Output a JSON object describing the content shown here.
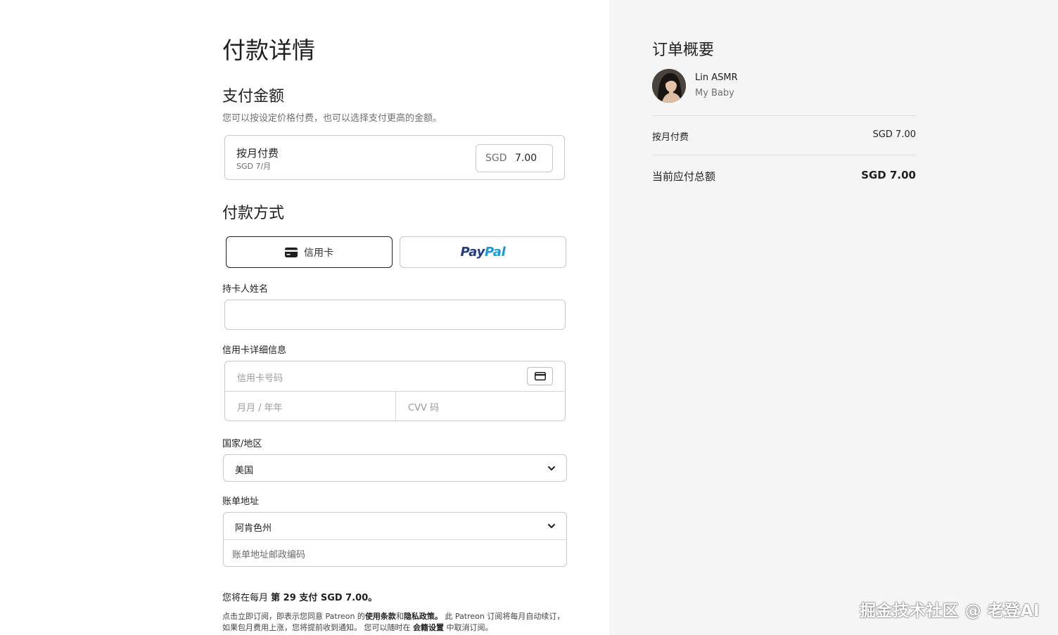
{
  "payment": {
    "title": "付款详情",
    "amount_section_title": "支付金额",
    "amount_section_desc": "您可以按设定价格付费，也可以选择支付更高的金额。",
    "plan_title": "按月付费",
    "plan_sub": "SGD 7/月",
    "currency": "SGD",
    "amount": "7.00",
    "method_section_title": "付款方式",
    "card_button_label": "信用卡",
    "paypal_pay": "Pay",
    "paypal_pal": "Pal",
    "cardholder_label": "持卡人姓名",
    "cardholder_value": "",
    "card_details_label": "信用卡详细信息",
    "card_number_placeholder": "信用卡号码",
    "expiry_placeholder": "月月 / 年年",
    "cvv_placeholder": "CVV 码",
    "country_label": "国家/地区",
    "country_value": "美国",
    "billing_label": "账单地址",
    "state_value": "阿肯色州",
    "zip_placeholder": "账单地址邮政编码",
    "notice_prefix": "您将在每月",
    "notice_bold": "第 29 支付 SGD 7.00。",
    "fine_1": "点击立即订阅，即表示您同意 Patreon 的",
    "fine_terms": "使用条款",
    "fine_and": "和",
    "fine_privacy": "隐私政策。",
    "fine_2": " 此 Patreon 订阅将每月自动续订，如果包月费用上涨，您将提前收到通知。 您可以随时在 ",
    "fine_settings": "会籍设置",
    "fine_3": " 中取消订阅。"
  },
  "summary": {
    "title": "订单概要",
    "creator": "Lin ASMR",
    "tier": "My Baby",
    "line_label": "按月付费",
    "line_value": "SGD 7.00",
    "total_label": "当前应付总额",
    "total_value": "SGD 7.00"
  },
  "watermark": "掘金技术社区 @ 老登AI",
  "colors": {
    "paypal_dark": "#253b80",
    "paypal_light": "#179bd7",
    "summary_bg": "#f5f5f5"
  }
}
